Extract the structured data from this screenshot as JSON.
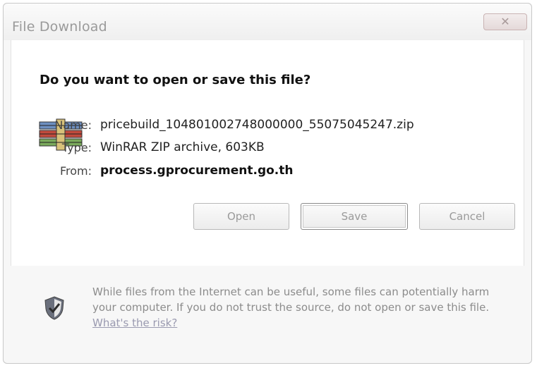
{
  "window": {
    "title": "File Download",
    "close_label": "✕"
  },
  "dialog": {
    "question": "Do you want to open or save this file?",
    "file": {
      "name_label": "Name:",
      "name_value": "pricebuild_104801002748000000_55075045247.zip",
      "type_label": "Type:",
      "type_value": "WinRAR ZIP archive, 603KB",
      "from_label": "From:",
      "from_value": "process.gprocurement.go.th"
    },
    "buttons": {
      "open": "Open",
      "save": "Save",
      "cancel": "Cancel"
    }
  },
  "warning": {
    "text": "While files from the Internet can be useful, some files can potentially harm your computer. If you do not trust the source, do not open or save this file.",
    "link": "What's the risk?"
  },
  "icons": {
    "file": "winrar-archive-icon",
    "warning": "shield-icon"
  }
}
